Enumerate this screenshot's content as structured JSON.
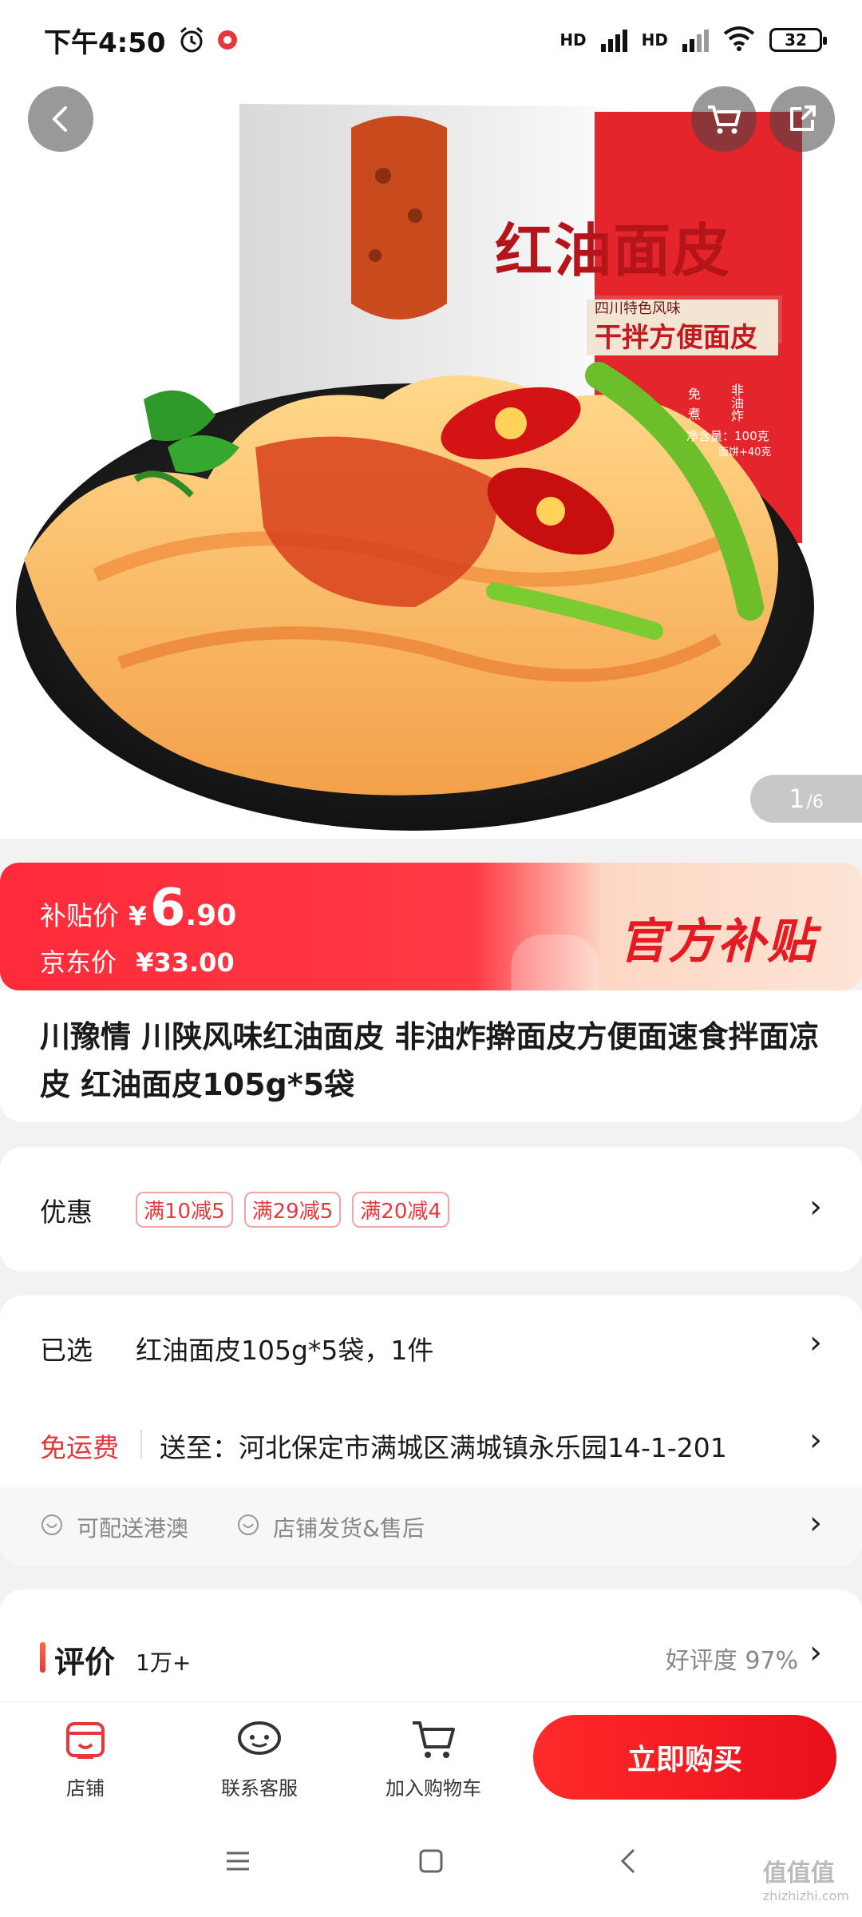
{
  "status": {
    "time": "下午4:50",
    "hd1": "HD",
    "hd2": "HD",
    "battery": "32"
  },
  "gallery": {
    "pager_current": "1",
    "pager_total": "/6",
    "package_title": "红油面皮",
    "package_sub1": "四川特色风味",
    "package_sub2": "干拌方便面皮",
    "package_side1": "免",
    "package_side2": "煮",
    "package_side3": "非油炸",
    "package_net": "净含量：100克",
    "package_net2": "面饼+40克"
  },
  "price": {
    "subsidy_label": "补贴价",
    "currency": "¥",
    "subsidy_int": "6",
    "subsidy_dec": ".90",
    "jd_label": "京东价",
    "jd_price": "¥33.00",
    "official_text": "官方补贴"
  },
  "product": {
    "title": "川豫情 川陕风味红油面皮 非油炸擀面皮方便面速食拌面凉皮 红油面皮105g*5袋"
  },
  "promo": {
    "label": "优惠",
    "tags": [
      "满10减5",
      "满29减5",
      "满20减4"
    ]
  },
  "selection": {
    "label": "已选",
    "value": "红油面皮105g*5袋，1件",
    "shipping_label": "免运费",
    "ship_to": "送至：河北保定市满城区满城镇永乐园14-1-201",
    "service1": "可配送港澳",
    "service2": "店铺发货&售后"
  },
  "reviews": {
    "label": "评价",
    "count": "1万+",
    "rate": "好评度 97%"
  },
  "actions": {
    "shop": "店铺",
    "service": "联系客服",
    "cart": "加入购物车",
    "buy": "立即购买"
  },
  "watermark": {
    "text": "值值值",
    "url": "zhizhizhi.com"
  },
  "colors": {
    "accent": "#e4393c",
    "buy_button": "#f0151f"
  }
}
